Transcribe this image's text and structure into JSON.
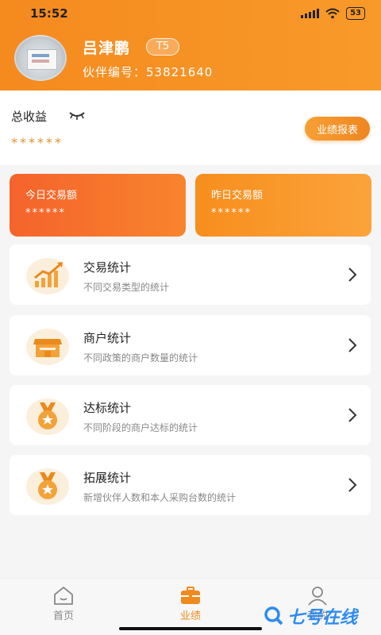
{
  "status_bar": {
    "time": "15:52",
    "battery": "53"
  },
  "header": {
    "user_name": "吕津鹏",
    "level": "T5",
    "partner_no": "伙伴编号：53821640"
  },
  "total": {
    "label": "总收益",
    "value": "******",
    "report_button": "业绩报表"
  },
  "stats": [
    {
      "label": "今日交易额",
      "value": "******"
    },
    {
      "label": "昨日交易额",
      "value": "******"
    }
  ],
  "menu": [
    {
      "title": "交易统计",
      "desc": "不同交易类型的统计",
      "icon": "chart-trend-icon"
    },
    {
      "title": "商户统计",
      "desc": "不同政策的商户数量的统计",
      "icon": "store-icon"
    },
    {
      "title": "达标统计",
      "desc": "不同阶段的商户达标的统计",
      "icon": "medal-icon"
    },
    {
      "title": "拓展统计",
      "desc": "新增伙伴人数和本人采购台数的统计",
      "icon": "medal-icon"
    }
  ],
  "nav": [
    {
      "label": "首页",
      "icon": "home-icon"
    },
    {
      "label": "业绩",
      "icon": "briefcase-icon"
    },
    {
      "label": "我的",
      "icon": "user-icon"
    }
  ],
  "watermark": "七号在线",
  "colors": {
    "accent": "#f58a1f",
    "accent_red": "#f5632c",
    "text_muted": "#888888"
  }
}
